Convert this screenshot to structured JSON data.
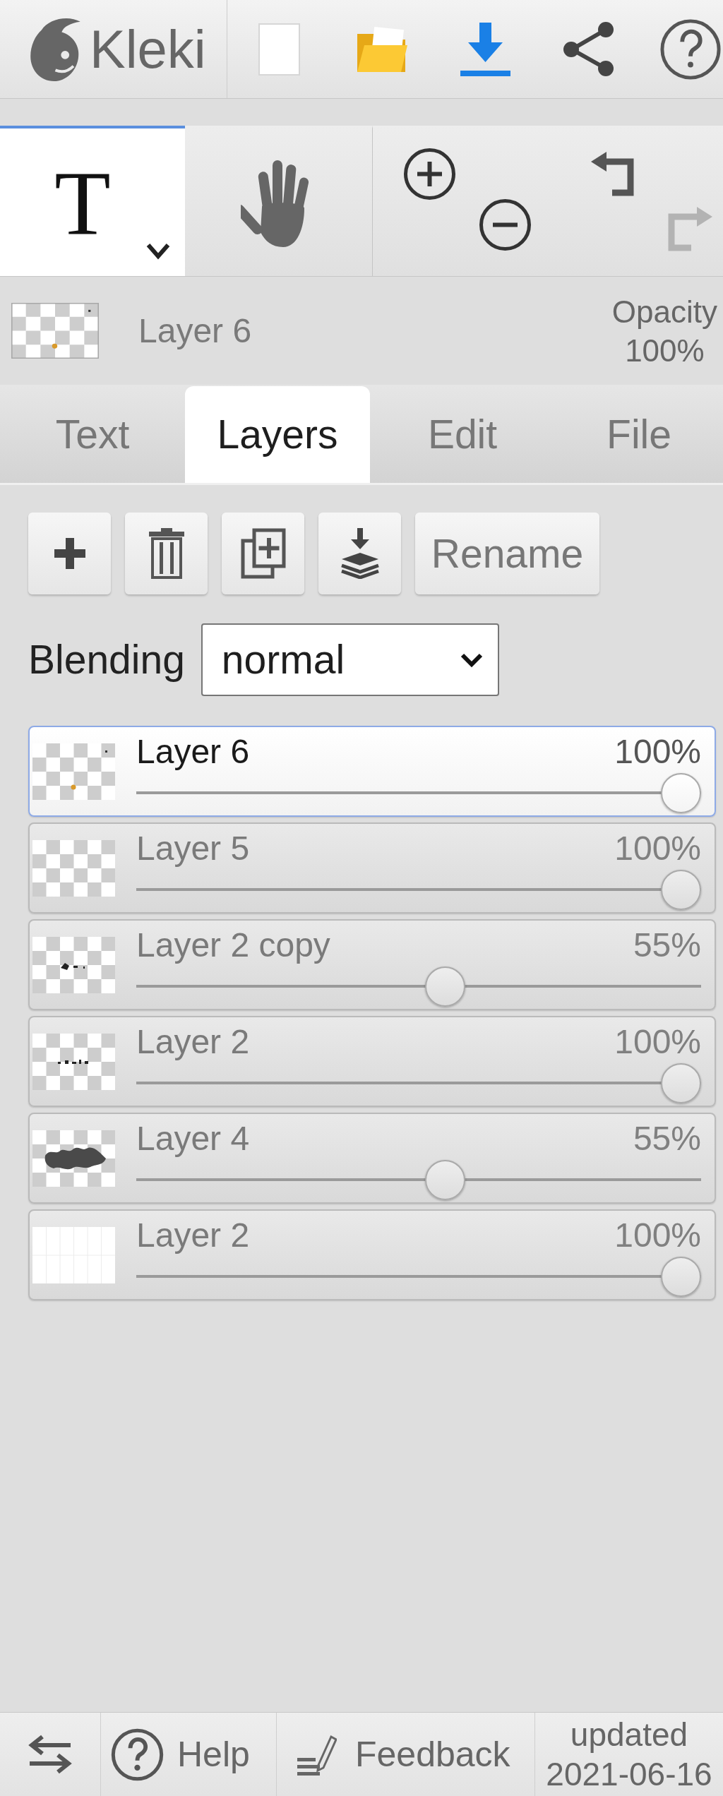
{
  "app_bar": {
    "logo_text": "Kleki"
  },
  "tools": [
    {
      "kind": "text",
      "icon_text": "T",
      "selected": true
    },
    {
      "kind": "hand",
      "selected": false
    }
  ],
  "history": {
    "undo": {
      "disabled": false
    },
    "redo": {
      "disabled": true
    }
  },
  "current_layer": {
    "kind": "dot",
    "name": "Layer 6",
    "opacity_label": "Opacity",
    "opacity": "100%"
  },
  "tabs": [
    {
      "label": "Text",
      "selected": false
    },
    {
      "label": "Layers",
      "selected": true
    },
    {
      "label": "Edit",
      "selected": false
    },
    {
      "label": "File",
      "selected": false
    }
  ],
  "layer_actions": {
    "rename": "Rename"
  },
  "blending": {
    "label": "Blending",
    "value": "normal"
  },
  "layers": [
    {
      "kind": "dot",
      "name": "Layer 6",
      "opacity": "100%",
      "level": 1,
      "selected": true
    },
    {
      "kind": "empty",
      "name": "Layer 5",
      "opacity": "100%",
      "level": 1,
      "selected": false
    },
    {
      "kind": "marks",
      "name": "Layer 2 copy",
      "opacity": "55%",
      "level": 0.55,
      "selected": false
    },
    {
      "kind": "scribble",
      "name": "Layer 2",
      "opacity": "100%",
      "level": 1,
      "selected": false
    },
    {
      "kind": "blob",
      "name": "Layer 4",
      "opacity": "55%",
      "level": 0.55,
      "selected": false
    },
    {
      "kind": "white",
      "name": "Layer 2",
      "opacity": "100%",
      "level": 1,
      "selected": false
    }
  ],
  "footer": {
    "help": "Help",
    "feedback": "Feedback",
    "updated_label": "updated",
    "updated_date": "2021-06-16"
  }
}
